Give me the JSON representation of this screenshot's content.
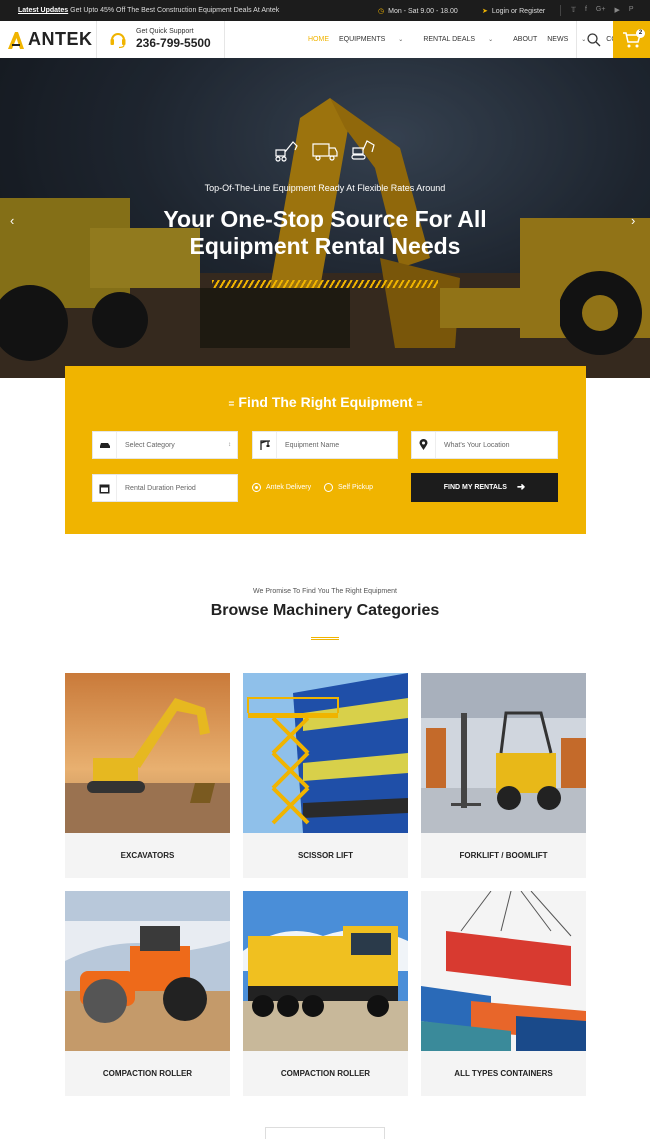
{
  "topbar": {
    "updates_label": "Latest Updates",
    "updates_text": "Get Upto 45% Off The Best Construction Equipment Deals At Antek",
    "hours": "Mon - Sat 9.00 - 18.00",
    "login": "Login or Register",
    "socials": [
      "twitter-icon",
      "facebook-icon",
      "google-plus-icon",
      "youtube-icon",
      "pinterest-icon"
    ]
  },
  "header": {
    "logo_text": "ANTEK",
    "support_label": "Get Quick Support",
    "phone": "236-799-5500",
    "nav": [
      {
        "label": "HOME",
        "active": true
      },
      {
        "label": "EQUIPMENTS",
        "dropdown": true
      },
      {
        "label": "RENTAL DEALS",
        "dropdown": true
      },
      {
        "label": "ABOUT"
      },
      {
        "label": "NEWS",
        "dropdown": true
      },
      {
        "label": "CONTACT"
      }
    ],
    "cart_count": "2"
  },
  "hero": {
    "subtitle": "Top-Of-The-Line Equipment Ready At Flexible Rates Around",
    "title_line1": "Your One-Stop Source For All",
    "title_line2": "Equipment Rental Needs"
  },
  "find": {
    "title": "Find The Right Equipment",
    "category_placeholder": "Select Category",
    "equipment_placeholder": "Equipment Name",
    "location_placeholder": "What's Your Location",
    "duration_placeholder": "Rental Duration Period",
    "option_delivery": "Antek Delivery",
    "option_pickup": "Self Pickup",
    "button": "FIND MY RENTALS"
  },
  "categories": {
    "subtitle": "We Promise To Find You The Right Equipment",
    "title": "Browse Machinery Categories",
    "items": [
      {
        "name": "EXCAVATORS"
      },
      {
        "name": "SCISSOR LIFT"
      },
      {
        "name": "FORKLIFT / BOOMLIFT"
      },
      {
        "name": "COMPACTION ROLLER"
      },
      {
        "name": "COMPACTION ROLLER"
      },
      {
        "name": "ALL TYPES CONTAINERS"
      }
    ]
  },
  "colors": {
    "accent": "#f0b400",
    "dark": "#1c1c1c"
  }
}
